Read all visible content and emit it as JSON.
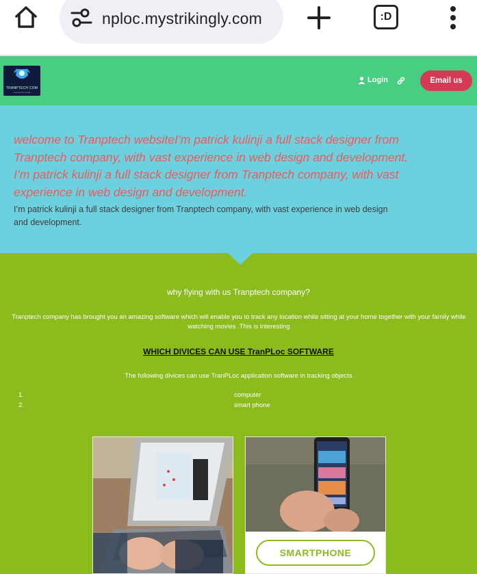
{
  "browser": {
    "url": "nploc.mystrikingly.com",
    "tabs_label": ":D"
  },
  "header": {
    "logo_text": "TRANPTECH COM",
    "logo_sub": "you can be moved",
    "login_label": "Login",
    "email_button": "Email us"
  },
  "hero": {
    "heading": "welcome to Tranptech websiteI’m patrick kulinji a full stack designer from Tranptech company, with vast experience in web design and development. I’m patrick kulinji a full stack designer from Tranptech company, with vast experience in web design and development.",
    "subtext": "I’m patrick kulinji a full stack designer from Tranptech company, with vast experience in web design and development."
  },
  "section": {
    "title": "why flying with us Tranptech company?",
    "description": "Tranptech company has brought you an amazing software which will enable you to track any location while sitting at your home together with your family while watching movies .This is interesting",
    "devices_heading": "WHICH DIVICES CAN USE TranPLoc SOFTWARE",
    "devices_note": "The following divices can use TranPLoc application software in tracking objects",
    "devices": [
      {
        "num": "1.",
        "name": "computer"
      },
      {
        "num": "2.",
        "name": "smart phone"
      }
    ]
  },
  "cards": {
    "phone_button": "SMARTPHONE"
  },
  "colors": {
    "header_green": "#48cd82",
    "hero_blue": "#6dd0df",
    "section_green": "#8cbb1e",
    "email_red": "#d53a54",
    "heading_red": "#ec5a5a"
  }
}
